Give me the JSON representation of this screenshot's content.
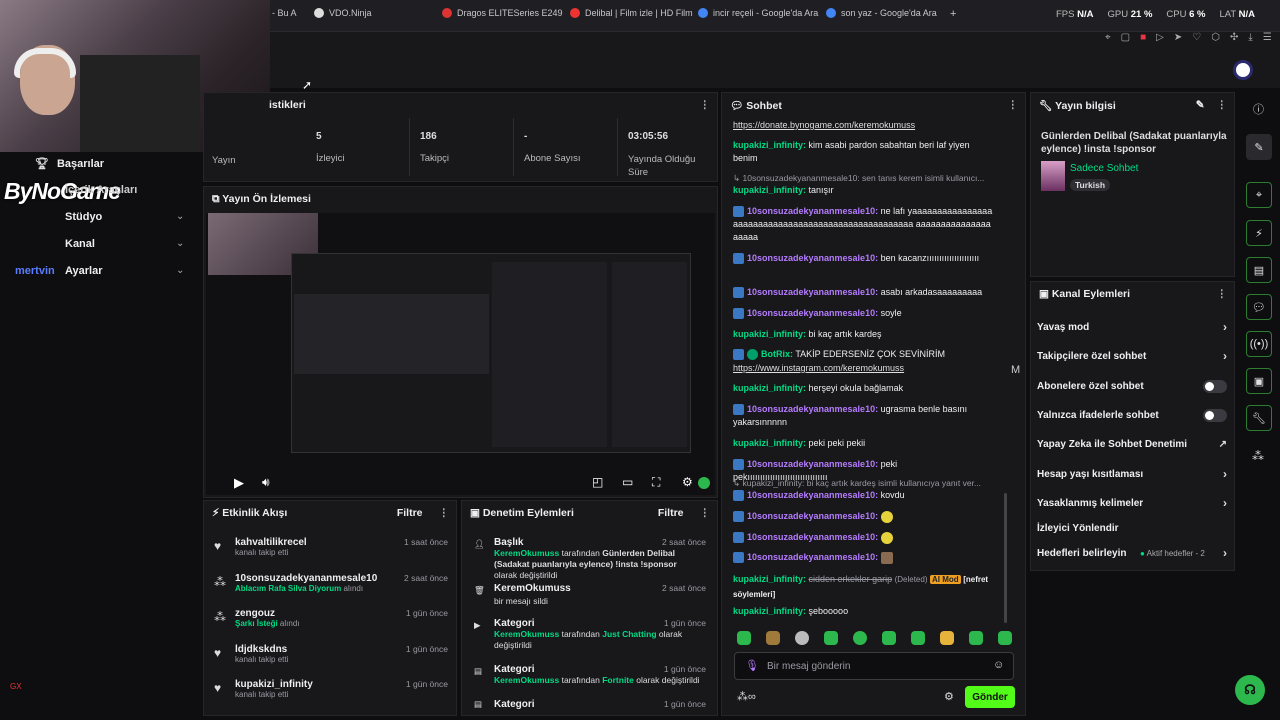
{
  "browser": {
    "tabs": [
      {
        "label": "- Bu A",
        "color": "#c33"
      },
      {
        "label": "VDO.Ninja",
        "color": "#ddd"
      },
      {
        "label": "Dragos ELITESeries E249",
        "color": "#d33"
      },
      {
        "label": "Delibal | Film izle | HD Film",
        "color": "#e33"
      },
      {
        "label": "incir reçeli - Google'da Ara",
        "color": "#4285f4"
      },
      {
        "label": "son yaz - Google'da Ara",
        "color": "#4285f4"
      }
    ],
    "new_tab": "+",
    "stats": {
      "fps_label": "FPS",
      "fps": "N/A",
      "gpu_label": "GPU",
      "gpu": "21 %",
      "cpu_label": "CPU",
      "cpu": "6 %",
      "lat_label": "LAT",
      "lat": "N/A"
    }
  },
  "overlay": {
    "brand": "ByNoGame",
    "sub": "mertvin",
    "gx": "GX"
  },
  "sidebar": {
    "items": [
      {
        "label": "Başarılar",
        "icon": "trophy-icon"
      },
      {
        "label": "İçerik Araçları",
        "icon": "tools-icon"
      },
      {
        "label": "Stüdyo",
        "icon": "studio-icon"
      },
      {
        "label": "Kanal",
        "icon": "channel-icon"
      },
      {
        "label": "Ayarlar",
        "icon": "settings-icon"
      }
    ]
  },
  "stats_panel": {
    "title": "istikleri",
    "items": [
      {
        "value": "",
        "label": "Yayın"
      },
      {
        "value": "5",
        "label": "İzleyici"
      },
      {
        "value": "186",
        "label": "Takipçi"
      },
      {
        "value": "-",
        "label": "Abone Sayısı"
      },
      {
        "value": "03:05:56",
        "label": "Yayında Olduğu Süre"
      }
    ]
  },
  "preview": {
    "title": "Yayın Ön İzlemesi"
  },
  "activity": {
    "title": "Etkinlik Akışı",
    "filter": "Filtre",
    "rows": [
      {
        "name": "kahvaltilikrecel",
        "sub": "kanalı takip etti",
        "highlight": "",
        "time": "1 saat önce"
      },
      {
        "name": "10sonsuzadekyananmesale10",
        "sub": "alındı",
        "highlight": "Ablacım Rafa Silva Diyorum",
        "time": "2 saat önce"
      },
      {
        "name": "zengouz",
        "sub": "alındı",
        "highlight": "Şarkı İsteği",
        "time": "1 gün önce"
      },
      {
        "name": "ldjdkskdns",
        "sub": "kanalı takip etti",
        "highlight": "",
        "time": "1 gün önce"
      },
      {
        "name": "kupakizi_infinity",
        "sub": "kanalı takip etti",
        "highlight": "",
        "time": "1 gün önce"
      }
    ]
  },
  "moderation": {
    "title": "Denetim Eylemleri",
    "filter": "Filtre",
    "rows": [
      {
        "title": "Başlık",
        "user": "KeremOkumuss",
        "mid": "tarafından",
        "hl": "Günlerden Delibal (Sadakat puanlarıyla eylence) !insta !sponsor",
        "end": "olarak değiştirildi",
        "time": "2 saat önce"
      },
      {
        "title": "KeremOkumuss",
        "user": "",
        "mid": "",
        "hl": "",
        "end": "bir mesajı sildi",
        "time": "2 saat önce"
      },
      {
        "title": "Kategori",
        "user": "KeremOkumuss",
        "mid": "tarafından",
        "hl": "Just Chatting",
        "end": "olarak değiştirildi",
        "time": "1 gün önce"
      },
      {
        "title": "Kategori",
        "user": "KeremOkumuss",
        "mid": "tarafından",
        "hl": "Fortnite",
        "end": "olarak değiştirildi",
        "time": "1 gün önce"
      },
      {
        "title": "Kategori",
        "user": "",
        "mid": "",
        "hl": "",
        "end": "",
        "time": "1 gün önce"
      }
    ]
  },
  "chat": {
    "title": "Sohbet",
    "link1": "https://donate.bynogame.com/keremokumuss",
    "messages": [
      {
        "user": "kupakizi_infinity:",
        "text": "kim asabi pardon sabahtan beri laf yiyen benim",
        "color": "#00db84"
      },
      {
        "sys": "10sonsuzadekyananmesale10: sen tanıs kerem isimli kullanıcı..."
      },
      {
        "user": "kupakizi_infinity:",
        "text": "tanışır",
        "color": "#00db84"
      },
      {
        "user": "10sonsuzadekyananmesale10:",
        "text": "ne lafı yaaaaaaaaaaaaaaaaaaaaaaaaaaaaaaaaaaaaaaaaaaaaaaaaaaaa aaaaaaaaaaaaaaaaaaaa",
        "color": "#b57bff"
      },
      {
        "user": "10sonsuzadekyananmesale10:",
        "text": "ben kacanzııııııııııııııııııııı",
        "color": "#b57bff"
      },
      {
        "user": "10sonsuzadekyananmesale10:",
        "text": "asabı arkadasaaaaaaaaa",
        "color": "#b57bff"
      },
      {
        "user": "10sonsuzadekyananmesale10:",
        "text": "soyle",
        "color": "#b57bff"
      },
      {
        "user": "kupakizi_infinity:",
        "text": "bi kaç artık kardeş",
        "color": "#00db84"
      },
      {
        "user": "BotRix:",
        "text": "TAKİP EDERSENİZ ÇOK SEVİNİRİM",
        "color": "#00db84"
      },
      {
        "link": "https://www.instagram.com/keremokumuss"
      },
      {
        "user": "kupakizi_infinity:",
        "text": "herşeyi okula bağlamak",
        "color": "#00db84"
      },
      {
        "user": "10sonsuzadekyananmesale10:",
        "text": "ugrasma benle basını yakarsınnnnn",
        "color": "#b57bff"
      },
      {
        "user": "kupakizi_infinity:",
        "text": "peki peki pekii",
        "color": "#00db84"
      },
      {
        "user": "10sonsuzadekyananmesale10:",
        "text": "peki pekıııııııııııııııııııııııııııııııı",
        "color": "#b57bff"
      },
      {
        "sys": "kupakizi_infinity: bi kaç artık kardeş isimli kullanıcıya yanıt ver..."
      },
      {
        "user": "10sonsuzadekyananmesale10:",
        "text": "kovdu",
        "color": "#b57bff"
      },
      {
        "user": "10sonsuzadekyananmesale10:",
        "text": "",
        "color": "#b57bff"
      },
      {
        "user": "10sonsuzadekyananmesale10:",
        "text": "",
        "color": "#b57bff"
      },
      {
        "user": "10sonsuzadekyananmesale10:",
        "text": "",
        "color": "#b57bff"
      },
      {
        "user": "kupakizi_infinity:",
        "text": "cidden erkekler garip",
        "deleted": "(Deleted)",
        "tag": "AI Mod",
        "extra": "[nefret söylemleri]",
        "color": "#00db84"
      },
      {
        "user": "kupakizi_infinity:",
        "text": "şebooooo",
        "color": "#00db84"
      }
    ],
    "placeholder": "Bir mesaj gönderin",
    "send": "Gönder",
    "m_key": "M"
  },
  "info": {
    "title": "Yayın bilgisi",
    "stream_title": "Günlerden Delibal (Sadakat puanlarıyla eylence) !insta !sponsor",
    "category": "Sadece Sohbet",
    "tag": "Turkish"
  },
  "channel_actions": {
    "title": "Kanal Eylemleri",
    "items": [
      {
        "label": "Yavaş mod",
        "type": "chevron"
      },
      {
        "label": "Takipçilere özel sohbet",
        "type": "chevron"
      },
      {
        "label": "Abonelere özel sohbet",
        "type": "toggle"
      },
      {
        "label": "Yalnızca ifadelerle sohbet",
        "type": "toggle"
      },
      {
        "label": "Yapay Zeka ile Sohbet Denetimi",
        "type": "external"
      },
      {
        "label": "Hesap yaşı kısıtlaması",
        "type": "chevron"
      },
      {
        "label": "Yasaklanmış kelimeler",
        "type": "chevron"
      },
      {
        "label": "İzleyici Yönlendir",
        "type": "none"
      },
      {
        "label": "Hedefleri belirleyin",
        "type": "goals",
        "extra": "Aktif hedefler - 2"
      }
    ]
  }
}
